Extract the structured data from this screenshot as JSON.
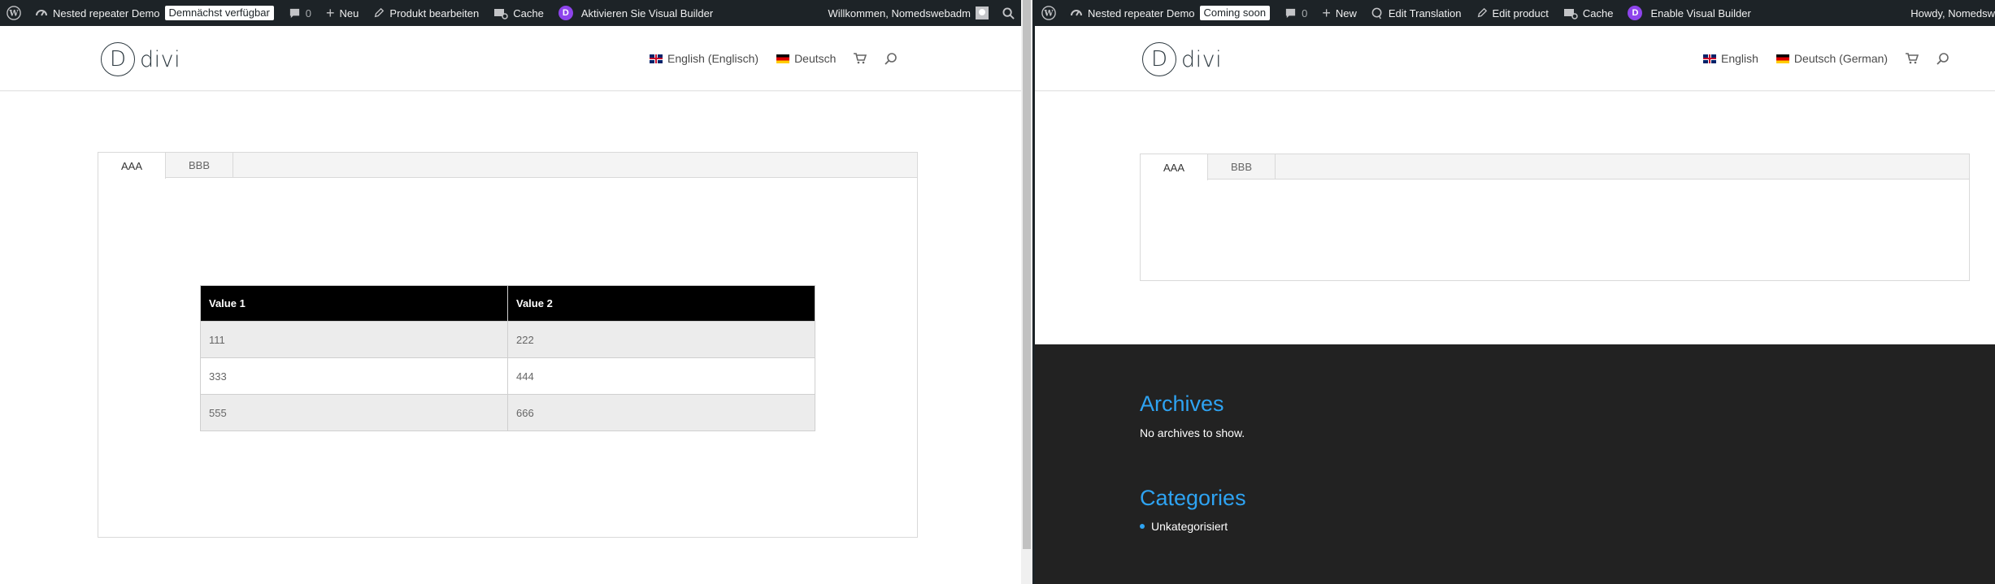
{
  "left_pane": {
    "adminbar": {
      "site_name": "Nested repeater Demo",
      "status_badge": "Demnächst verfügbar",
      "comments_count": "0",
      "new_label": "Neu",
      "edit_label": "Produkt bearbeiten",
      "cache_label": "Cache",
      "visual_builder_label": "Aktivieren Sie Visual Builder",
      "greeting": "Willkommen, Nomedswebadm"
    },
    "header": {
      "logo_text": "divi",
      "nav": [
        {
          "label": "English (Englisch)",
          "flag": "uk-flag"
        },
        {
          "label": "Deutsch",
          "flag": "de-flag"
        }
      ]
    },
    "tabs": [
      {
        "label": "AAA",
        "active": true
      },
      {
        "label": "BBB",
        "active": false
      }
    ],
    "table": {
      "headers": [
        "Value 1",
        "Value 2"
      ],
      "rows": [
        [
          "111",
          "222"
        ],
        [
          "333",
          "444"
        ],
        [
          "555",
          "666"
        ]
      ]
    }
  },
  "right_pane": {
    "adminbar": {
      "site_name": "Nested repeater Demo",
      "status_badge": "Coming soon",
      "comments_count": "0",
      "new_label": "New",
      "translation_label": "Edit Translation",
      "edit_label": "Edit product",
      "cache_label": "Cache",
      "visual_builder_label": "Enable Visual Builder",
      "greeting": "Howdy, Nomedsw"
    },
    "header": {
      "logo_text": "divi",
      "nav": [
        {
          "label": "English",
          "flag": "uk-flag"
        },
        {
          "label": "Deutsch (German)",
          "flag": "de-flag"
        }
      ]
    },
    "tabs": [
      {
        "label": "AAA",
        "active": true
      },
      {
        "label": "BBB",
        "active": false
      }
    ],
    "footer": {
      "archives_title": "Archives",
      "archives_text": "No archives to show.",
      "categories_title": "Categories",
      "categories": [
        "Unkategorisiert"
      ]
    }
  },
  "colors": {
    "admin_bar": "#1d2327",
    "accent_blue": "#2ea3f2",
    "footer_bg": "#222222",
    "divi_purple": "#8e44ec"
  }
}
